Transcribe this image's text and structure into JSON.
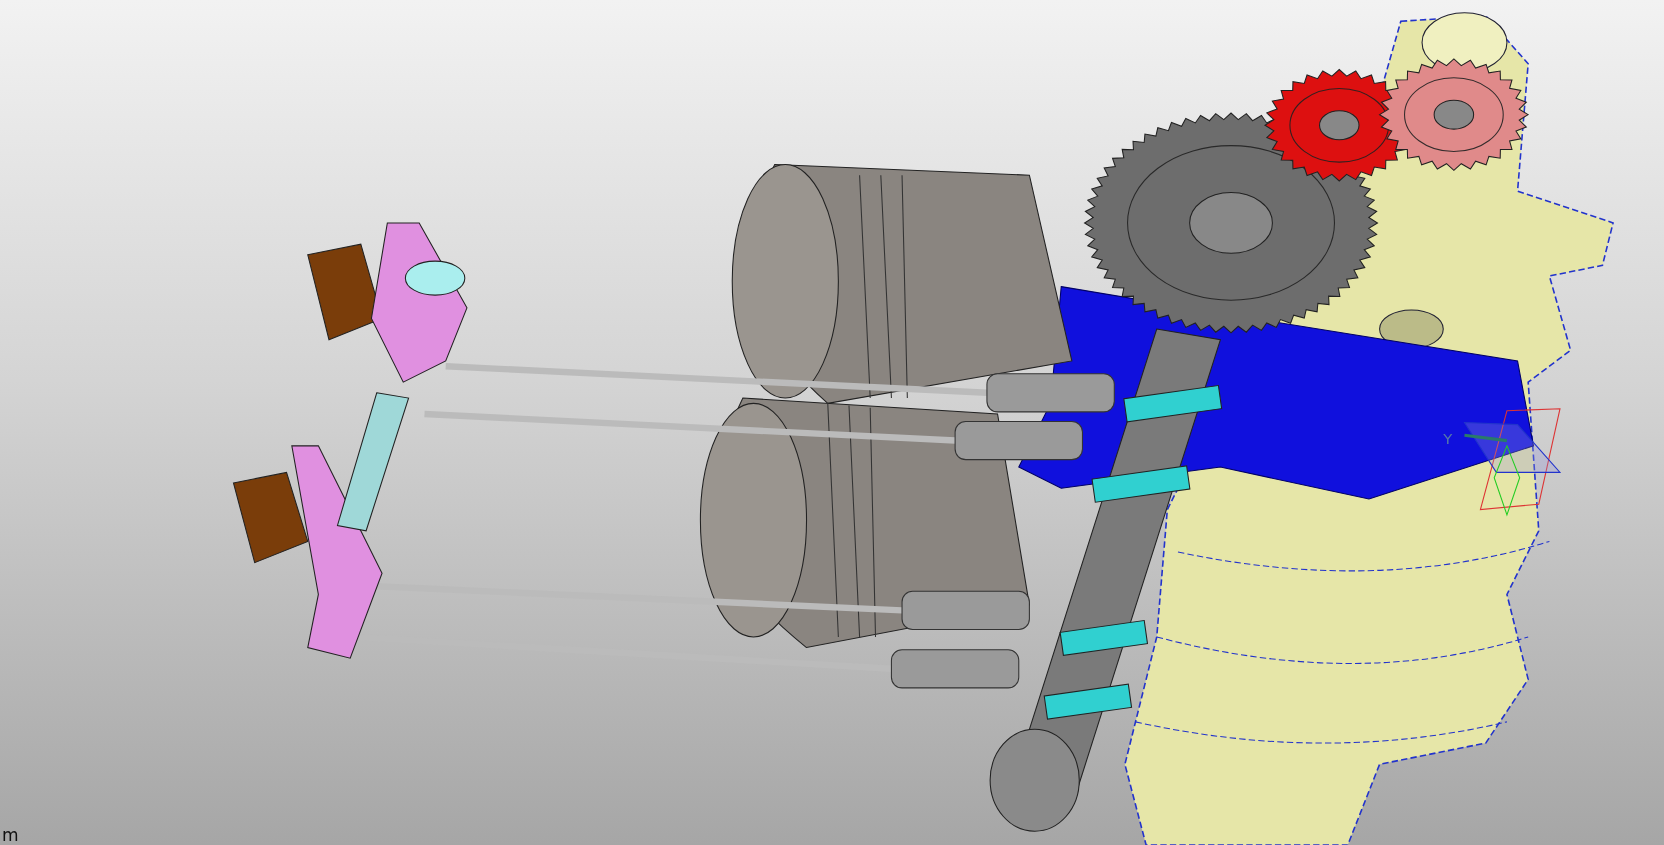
{
  "viewport": {
    "units_label": "m",
    "triad": {
      "axis_label": "Y"
    }
  }
}
